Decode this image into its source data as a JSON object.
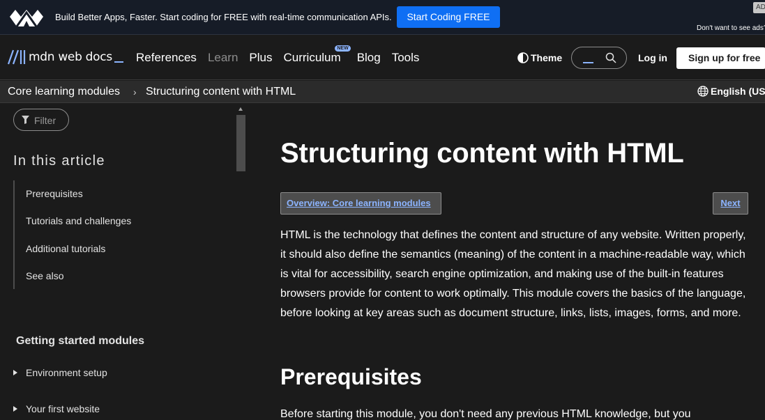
{
  "ad": {
    "text": "Build Better Apps, Faster. Start coding for FREE with real-time communication APIs.",
    "cta": "Start Coding FREE",
    "badge": "AD",
    "optout": "Don't want to see ads?"
  },
  "header": {
    "logo_text": "mdn web docs",
    "nav": [
      {
        "label": "References"
      },
      {
        "label": "Learn"
      },
      {
        "label": "Plus"
      },
      {
        "label": "Curriculum",
        "badge": "NEW"
      },
      {
        "label": "Blog"
      },
      {
        "label": "Tools"
      }
    ],
    "theme_label": "Theme",
    "login_label": "Log in",
    "signup_label": "Sign up for free"
  },
  "breadcrumb": {
    "items": [
      "Core learning modules",
      "Structuring content with HTML"
    ],
    "separator": "›",
    "language": "English (US)"
  },
  "sidebar": {
    "filter_label": "Filter",
    "toc_title": "In this article",
    "toc": [
      "Prerequisites",
      "Tutorials and challenges",
      "Additional tutorials",
      "See also"
    ],
    "modules_title": "Getting started modules",
    "modules": [
      "Environment setup",
      "Your first website"
    ]
  },
  "main": {
    "title": "Structuring content with HTML",
    "overview_link": "Overview: Core learning modules",
    "next_link": "Next",
    "intro": "HTML is the technology that defines the content and structure of any website. Written properly, it should also define the semantics (meaning) of the content in a machine-readable way, which is vital for accessibility, search engine optimization, and making use of the built-in features browsers provide for content to work optimally. This module covers the basics of the language, before looking at key areas such as document structure, links, lists, images, forms, and more.",
    "section_title": "Prerequisites",
    "section_text": "Before starting this module, you don't need any previous HTML knowledge, but you"
  },
  "colors": {
    "accent": "#8cb4ff",
    "ad_button": "#0f6ff4",
    "background": "#1b1b1b"
  }
}
